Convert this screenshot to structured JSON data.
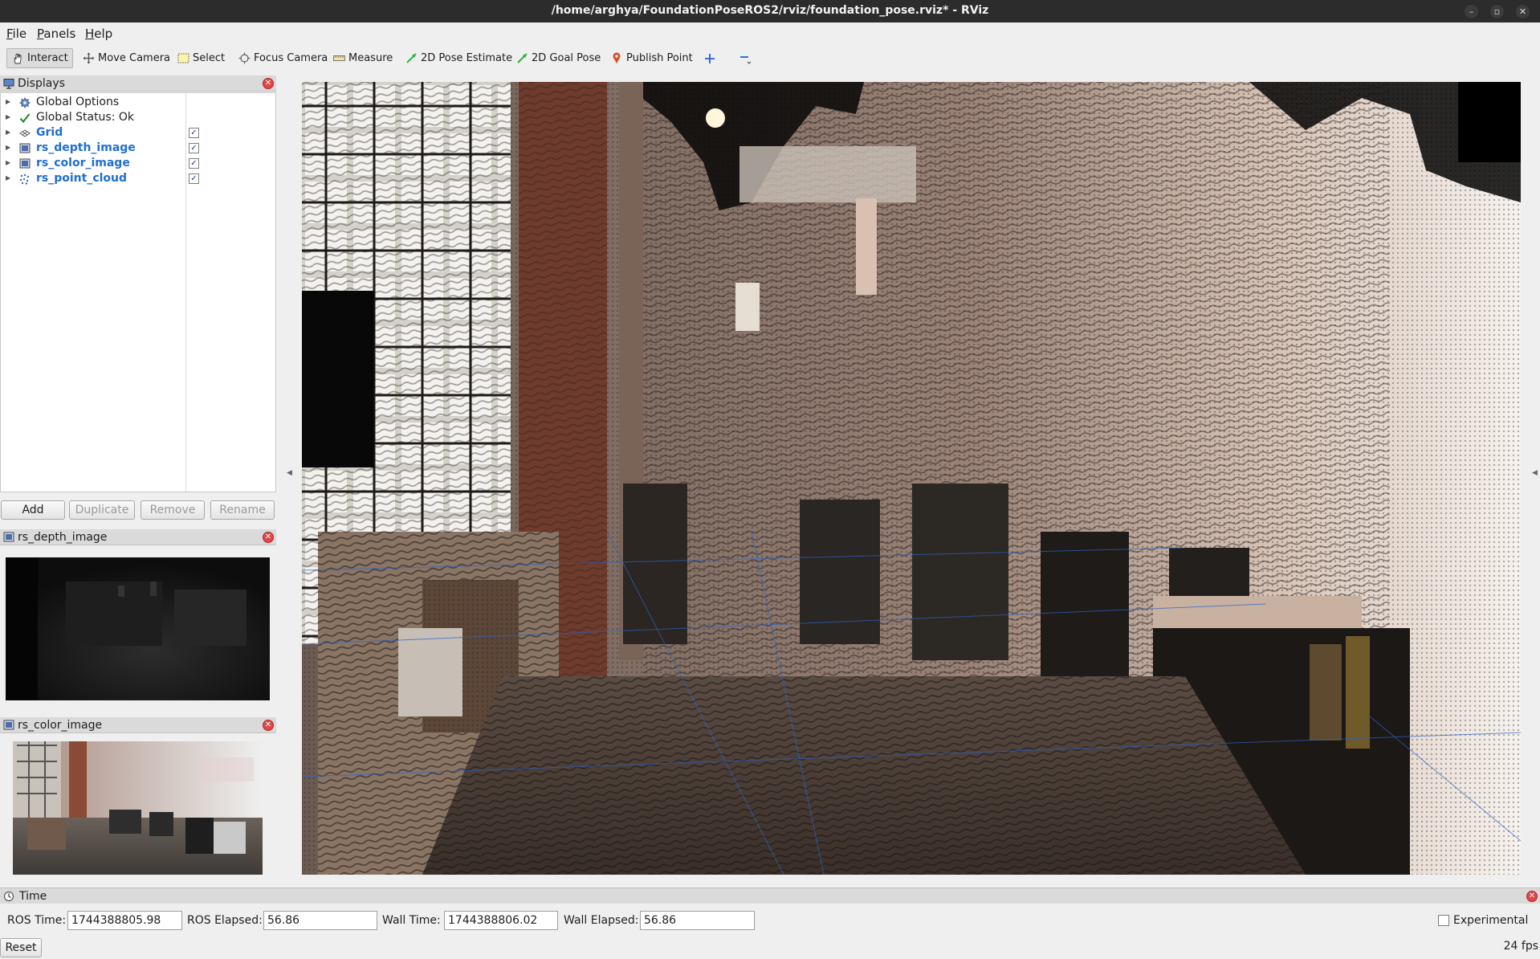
{
  "window": {
    "title": "/home/arghya/FoundationPoseROS2/rviz/foundation_pose.rviz* - RViz"
  },
  "menu": [
    "File",
    "Panels",
    "Help"
  ],
  "toolbar": {
    "tools": [
      {
        "label": "Interact",
        "icon": "hand-icon",
        "active": true
      },
      {
        "label": "Move Camera",
        "icon": "move-camera-icon",
        "active": false
      },
      {
        "label": "Select",
        "icon": "select-icon",
        "active": false
      },
      {
        "label": "Focus Camera",
        "icon": "focus-camera-icon",
        "active": false
      },
      {
        "label": "Measure",
        "icon": "ruler-icon",
        "active": false
      },
      {
        "label": "2D Pose Estimate",
        "icon": "pose-arrow-icon",
        "active": false
      },
      {
        "label": "2D Goal Pose",
        "icon": "goal-arrow-icon",
        "active": false
      },
      {
        "label": "Publish Point",
        "icon": "pin-icon",
        "active": false
      }
    ]
  },
  "displays": {
    "title": "Displays",
    "items": [
      {
        "label": "Global Options",
        "icon": "gear-icon",
        "checked": null,
        "highlight": false
      },
      {
        "label": "Global Status: Ok",
        "icon": "check-icon",
        "checked": null,
        "highlight": false
      },
      {
        "label": "Grid",
        "icon": "grid-icon",
        "checked": true,
        "highlight": true
      },
      {
        "label": "rs_depth_image",
        "icon": "image-icon",
        "checked": true,
        "highlight": true
      },
      {
        "label": "rs_color_image",
        "icon": "image-icon",
        "checked": true,
        "highlight": true
      },
      {
        "label": "rs_point_cloud",
        "icon": "point-cloud-icon",
        "checked": true,
        "highlight": true
      }
    ],
    "buttons": {
      "add": "Add",
      "duplicate": "Duplicate",
      "remove": "Remove",
      "rename": "Rename"
    }
  },
  "depth_panel": {
    "title": "rs_depth_image"
  },
  "color_panel": {
    "title": "rs_color_image"
  },
  "time_panel": {
    "title": "Time",
    "ros_time_label": "ROS Time:",
    "ros_time": "1744388805.98",
    "ros_elapsed_label": "ROS Elapsed:",
    "ros_elapsed": "56.86",
    "wall_time_label": "Wall Time:",
    "wall_time": "1744388806.02",
    "wall_elapsed_label": "Wall Elapsed:",
    "wall_elapsed": "56.86",
    "experimental_label": "Experimental",
    "reset_label": "Reset"
  },
  "status": {
    "fps": "24 fps"
  },
  "colors": {
    "accent_blue": "#1f6ed0",
    "close_red": "#e04848",
    "titlebar": "#2c2c2c"
  }
}
